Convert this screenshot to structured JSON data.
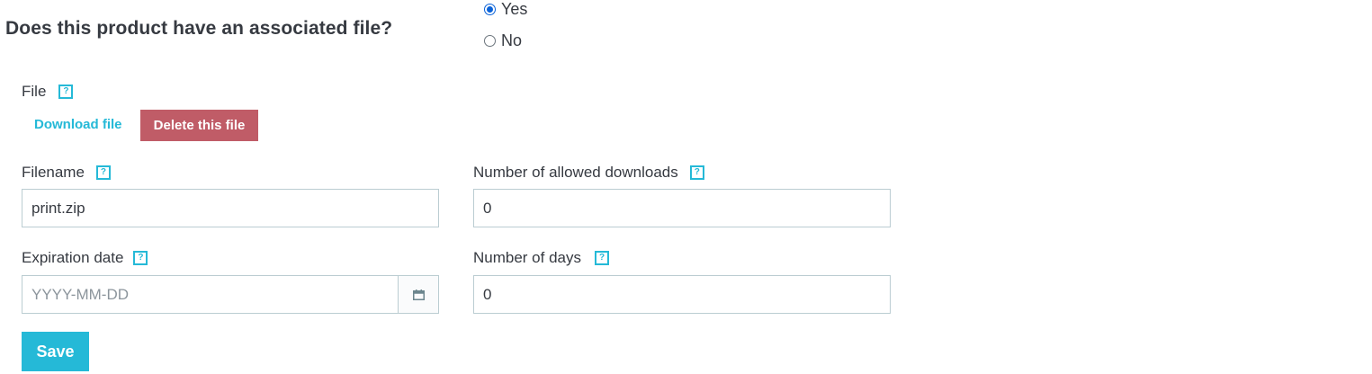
{
  "question": "Does this product have an associated file?",
  "options": [
    {
      "label": "Yes",
      "checked": true
    },
    {
      "label": "No",
      "checked": false
    }
  ],
  "file": {
    "label": "File",
    "help": "?",
    "download_label": "Download file",
    "delete_label": "Delete this file"
  },
  "filename": {
    "label": "Filename",
    "help": "?",
    "value": "print.zip"
  },
  "allowed_downloads": {
    "label": "Number of allowed downloads",
    "help": "?",
    "value": "0"
  },
  "expiration": {
    "label": "Expiration date",
    "help": "?",
    "placeholder": "YYYY-MM-DD",
    "icon": "calendar-icon"
  },
  "days": {
    "label": "Number of days",
    "help": "?",
    "value": "0"
  },
  "save_label": "Save",
  "colors": {
    "accent": "#25b9d7",
    "danger": "#c05c67",
    "radio": "#0a62d8",
    "text": "#363a41",
    "border": "#bbcdd2"
  }
}
